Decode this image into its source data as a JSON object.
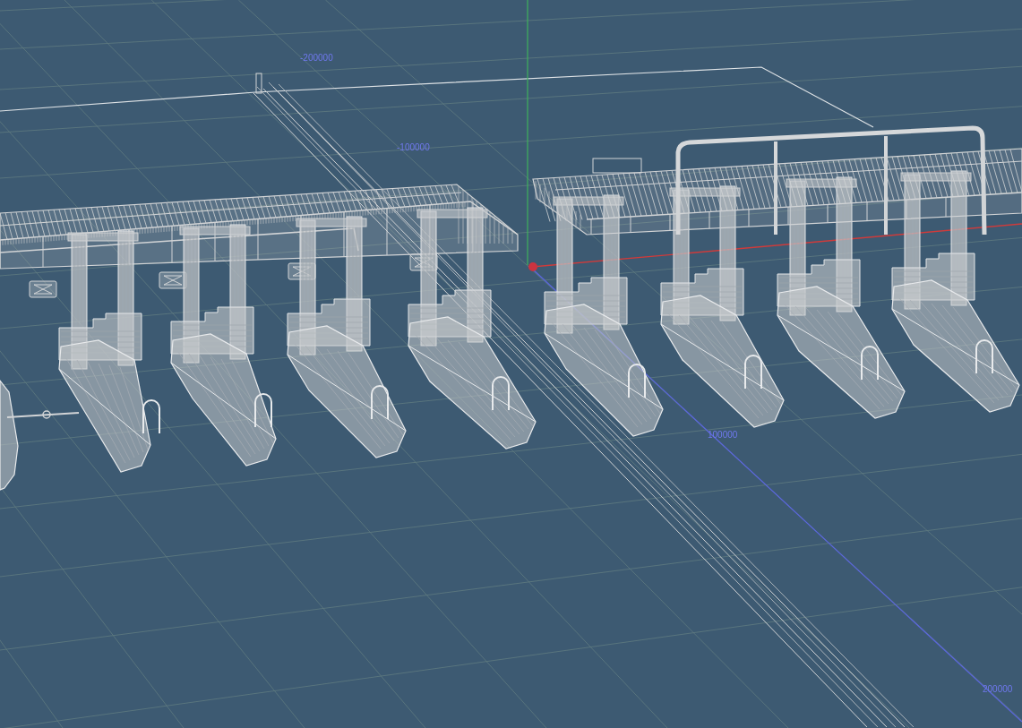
{
  "viewport": {
    "axis_labels": [
      "-200000",
      "-100000",
      "100000",
      "200000"
    ]
  }
}
